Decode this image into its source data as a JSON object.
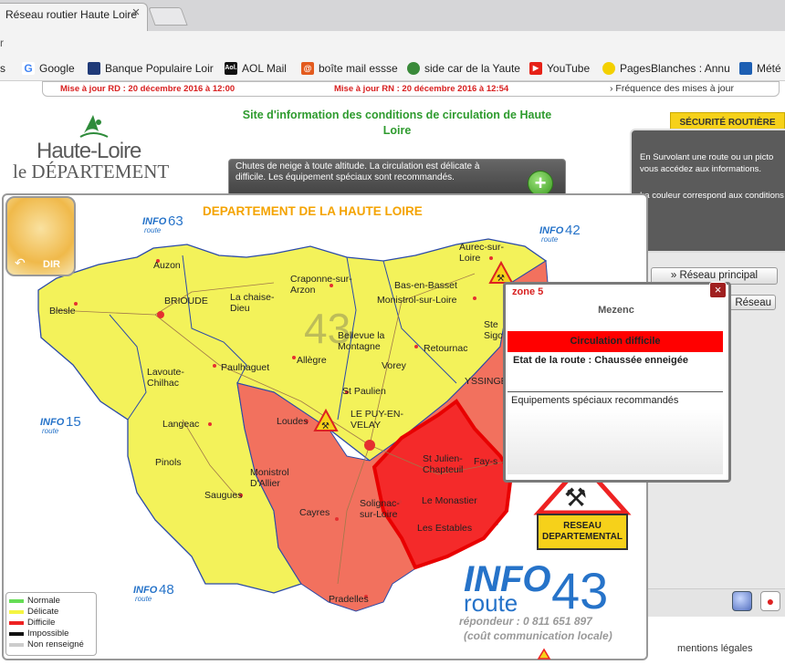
{
  "browser": {
    "tab_title": "Réseau routier Haute Loire",
    "tab_close": "×",
    "url_stub": "r",
    "bookmarks": [
      {
        "label": "s",
        "icon": "apps-icon"
      },
      {
        "label": "Google",
        "icon": "google-icon"
      },
      {
        "label": "Banque Populaire Loir",
        "icon": "bank-icon"
      },
      {
        "label": "AOL Mail",
        "icon": "aol-icon"
      },
      {
        "label": "boîte mail essse",
        "icon": "mail-icon"
      },
      {
        "label": "side car de la Yaute",
        "icon": "sidecar-icon"
      },
      {
        "label": "YouTube",
        "icon": "youtube-icon"
      },
      {
        "label": "PagesBlanches : Annu",
        "icon": "pagesblanches-icon"
      },
      {
        "label": "Mété",
        "icon": "meteo-icon"
      }
    ]
  },
  "updates": {
    "rd": "Mise à jour RD : 20 décembre 2016 à 12:00",
    "rn": "Mise à jour RN : 20 décembre 2016 à 12:54",
    "frequency": "Fréquence des mises à jour"
  },
  "logo": {
    "line1": "Haute-Loire",
    "line2": "le DÉPARTEMENT"
  },
  "site_title": "Site d'information des conditions de circulation de Haute Loire",
  "banner": {
    "text": "Chutes de neige à toute altitude. La circulation est délicate à difficile. Les équipement spéciaux sont recommandés.",
    "plus": "+"
  },
  "securite_badge": "SÉCURITÉ ROUTIÈRE",
  "info_panel": {
    "text1": "En Survolant une route ou un picto vous accédez aux informations.",
    "text2": "La couleur correspond aux conditions"
  },
  "right_buttons": {
    "reseau_principal": "Réseau principal",
    "reseau_secondaire": "Réseau secondaire"
  },
  "map": {
    "dir_label": "DIR",
    "dept_title": "DEPARTEMENT DE LA HAUTE LOIRE",
    "big_number": "43",
    "inforoute_badges": [
      {
        "word": "INFO",
        "sub": "route",
        "num": "63"
      },
      {
        "word": "INFO",
        "sub": "route",
        "num": "42"
      },
      {
        "word": "INFO",
        "sub": "route",
        "num": "15"
      },
      {
        "word": "INFO",
        "sub": "route",
        "num": "48"
      }
    ],
    "towns": [
      "Auzon",
      "Blesle",
      "BRIOUDE",
      "La chaise-Dieu",
      "Craponne-sur-Arzon",
      "Aurec-sur-Loire",
      "Bas-en-Basset",
      "Monistrol-sur-Loire",
      "Bellevue la Montagne",
      "Allègre",
      "Retournac",
      "Ste Sigo",
      "Lavoute-Chilhac",
      "Paulhaguet",
      "Vorey",
      "St Paulien",
      "YSSINGEAUX",
      "Langeac",
      "Loudes",
      "LE PUY-EN-VELAY",
      "Pinols",
      "Monistrol D'Allier",
      "St Julien-Chapteuil",
      "Fay-s",
      "Saugues",
      "Cayres",
      "Solignac-sur-Loire",
      "Le Monastier",
      "Les Estables",
      "Pradelles"
    ],
    "legend": [
      {
        "label": "Normale",
        "color": "#66dd55"
      },
      {
        "label": "Délicate",
        "color": "#f5f542"
      },
      {
        "label": "Difficile",
        "color": "#ee2222"
      },
      {
        "label": "Impossible",
        "color": "#111111"
      },
      {
        "label": "Non renseigné",
        "color": "#cccccc"
      }
    ],
    "reseau_dept": "RESEAU DEPARTEMENTAL"
  },
  "inforoute43": {
    "info": "INFO",
    "route": "route",
    "num": "43",
    "repondeur": "répondeur : 0 811 651 897",
    "cout": "(coût communication locale)"
  },
  "popup": {
    "zone": "zone 5",
    "close": "×",
    "name": "Mezenc",
    "status": "Circulation difficile",
    "etat": "Etat de la route : Chaussée enneigée",
    "equipements": "Equipements spéciaux recommandés"
  },
  "footer": {
    "mentions": "mentions légales"
  },
  "colors": {
    "delicate": "#f5f542",
    "difficile": "#f26a5a",
    "difficile_dark": "#ee2020",
    "title_green": "#2e9b2e",
    "info_blue": "#2673c9"
  }
}
